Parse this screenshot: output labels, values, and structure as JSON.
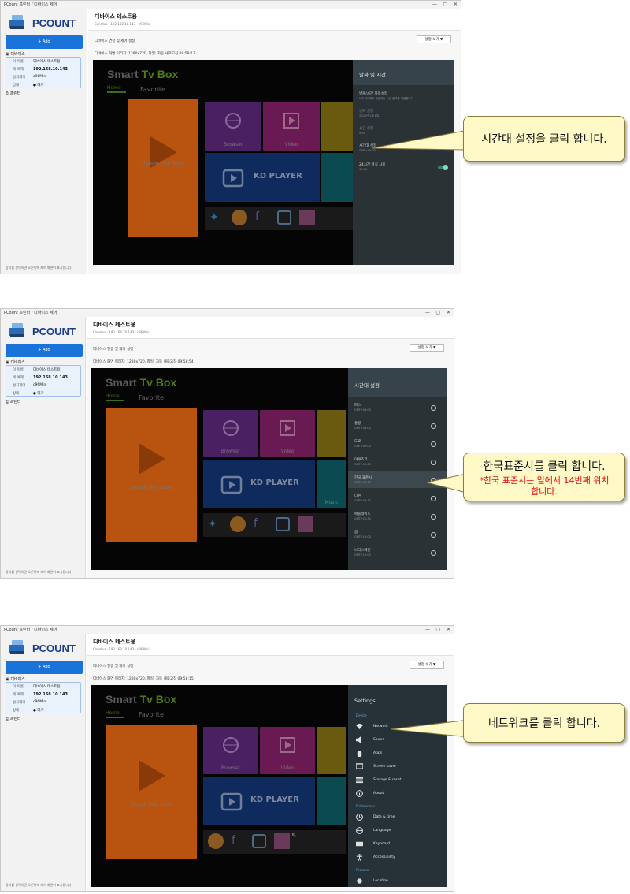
{
  "app": {
    "window_title": "PCount 프린터 / 디바이스 제어",
    "logo": "PCOUNT",
    "add_label": "+ Add",
    "devices_header": "디바이스",
    "printer_header": "프린터",
    "sidebar_footer": "장치를 선택하면 오른쪽에 제어 화면이 표시됩니다.",
    "device": {
      "rows": [
        {
          "key": "이 이름",
          "value": "디바이스 테스트용"
        },
        {
          "key": "에 예제",
          "value": "192.168.10.143"
        },
        {
          "key": "설치제어",
          "value": "c96Mini"
        },
        {
          "key": "상태",
          "value": "● 대기"
        }
      ]
    },
    "device_title": "디바이스 테스트용",
    "device_sub": "Conntus · 192.168.10.143 · c96Mini",
    "section_label": "디바이스 연결 및 제어 설정",
    "view_button": "설정 보기 ▼",
    "window_controls": [
      "—",
      "▢",
      "✕"
    ]
  },
  "tv": {
    "brand_a": "Smart",
    "brand_b": "Tv Box",
    "tab_home": "Home",
    "tab_fav": "Favorite",
    "tiles": {
      "play": "Google Play Store",
      "browser": "Browser",
      "video": "Video",
      "kd": "KD PLAYER",
      "music": "Music"
    }
  },
  "shots": [
    {
      "resolution": "디바이스 화면 미리지: 1280x720, 파일: 자동 새로고침 09:59:13",
      "panel_title": "날짜 및 시간",
      "items": [
        {
          "a": "날짜/시간 자동설정",
          "b": "네트워크에서 제공하는 시간 정보를 사용합니다",
          "dim": false
        },
        {
          "a": "날짜 설정",
          "b": "2023년 1월 6일",
          "dim": true
        },
        {
          "a": "시간 설정",
          "b": "9:59",
          "dim": true
        },
        {
          "a": "시간대 설정",
          "b": "GMT+09:00",
          "dim": false
        },
        {
          "a": "24시간 형식 사용",
          "b": "13:00",
          "dim": false
        }
      ],
      "callout": "시간대 설정을 클릭 합니다."
    },
    {
      "resolution": "디바이스 화면 미리지: 1280x720, 파일: 자동 새로고침 09:58:54",
      "panel_title": "시간대 설정",
      "zones": [
        {
          "a": "파스",
          "b": "GMT+05:00"
        },
        {
          "a": "홍콩",
          "b": "GMT+08:00"
        },
        {
          "a": "도쿄",
          "b": "GMT+09:00"
        },
        {
          "a": "야쿠츠크",
          "b": "GMT+09:00"
        },
        {
          "a": "한국 표준시",
          "b": "GMT+09:00"
        },
        {
          "a": "다윈",
          "b": "GMT+09:30"
        },
        {
          "a": "애들레이드",
          "b": "GMT+10:30"
        },
        {
          "a": "괌",
          "b": "GMT+10:00"
        },
        {
          "a": "브리스베인",
          "b": "GMT+10:00"
        }
      ],
      "callout": "한국표준시를 클릭 합니다.",
      "callout_note": "*한국 표준시는 밑에서 14번째 위치 합니다."
    },
    {
      "resolution": "디바이스 화면 미리지: 1280x720, 파일: 자동 새로고침 09:58:15",
      "panel_title": "Settings",
      "cat_device": "Device",
      "cat_pref": "Preferences",
      "cat_personal": "Personal",
      "device_items": [
        "Network",
        "Sound",
        "Apps",
        "Screen saver",
        "Storage & reset",
        "About"
      ],
      "pref_items": [
        "Date & time",
        "Language",
        "Keyboard",
        "Accessibility"
      ],
      "personal_items": [
        "Location"
      ],
      "callout": "네트워크를 클릭 합니다."
    }
  ]
}
